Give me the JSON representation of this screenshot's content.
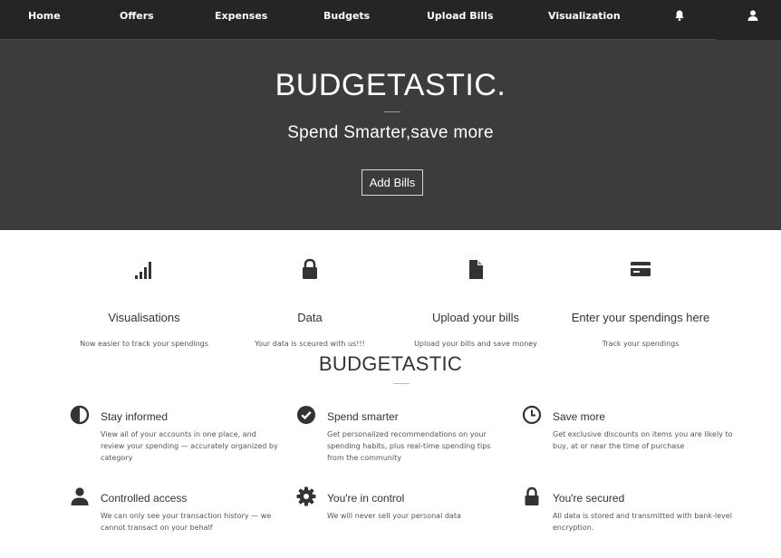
{
  "nav": {
    "items": [
      {
        "label": "Home"
      },
      {
        "label": "Offers"
      },
      {
        "label": "Expenses"
      },
      {
        "label": "Budgets"
      },
      {
        "label": "Upload Bills"
      },
      {
        "label": "Visualization"
      }
    ],
    "bell_icon": "bell-icon",
    "user_icon": "user-icon"
  },
  "hero": {
    "title": "BUDGETASTIC.",
    "subtitle": "Spend Smarter,save more",
    "button_label": "Add Bills"
  },
  "features": [
    {
      "icon": "signal-bars-icon",
      "title": "Visualisations",
      "desc": "Now easier to track your spendings"
    },
    {
      "icon": "lock-icon",
      "title": "Data",
      "desc": "Your data is sceured with us!!!"
    },
    {
      "icon": "file-icon",
      "title": "Upload your bills",
      "desc": "Upload your bills and save money"
    },
    {
      "icon": "credit-card-icon",
      "title": "Enter your spendings here",
      "desc": "Track your spendings"
    }
  ],
  "section_title": "BUDGETASTIC",
  "benefits": [
    {
      "icon": "half-circle-icon",
      "title": "Stay informed",
      "desc": "View all of your accounts in one place, and review your spending — accurately organized by category"
    },
    {
      "icon": "check-circle-icon",
      "title": "Spend smarter",
      "desc": "Get personalized recommendations on your spending habits, plus real-time spending tips from the community"
    },
    {
      "icon": "clock-icon",
      "title": "Save more",
      "desc": "Get exclusive discounts on items you are likely to buy, at or near the time of purchase"
    },
    {
      "icon": "person-icon",
      "title": "Controlled access",
      "desc": "We can only see your transaction history — we cannot transact on your behalf"
    },
    {
      "icon": "gear-icon",
      "title": "You're in control",
      "desc": "We will never sell your personal data"
    },
    {
      "icon": "lock-icon",
      "title": "You're secured",
      "desc": "All data is stored and transmitted with bank-level encryption."
    }
  ],
  "colors": {
    "navbar_bg": "#252525",
    "hero_bg": "#3c3c3c",
    "icon": "#333333"
  }
}
